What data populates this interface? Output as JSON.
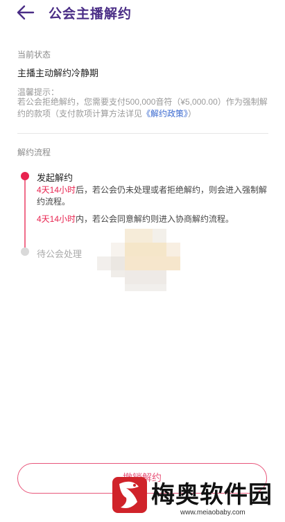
{
  "header": {
    "title": "公会主播解约",
    "back_icon": "arrow-left-icon"
  },
  "status": {
    "label": "当前状态",
    "value": "主播主动解约冷静期"
  },
  "tip": {
    "title": "温馨提示：",
    "body_prefix": "若公会拒绝解约，您需要支付500,000音符（¥5,000.00）作为强制解约的款项（支付款项计算方法详见",
    "link_text": "《解约政策》",
    "body_suffix": "）"
  },
  "process": {
    "label": "解约流程",
    "steps": [
      {
        "title": "发起解约",
        "lines": [
          {
            "highlight": "4天14小时",
            "text": "后，若公会仍未处理或者拒绝解约，则会进入强制解约流程。"
          },
          {
            "highlight": "4天14小时",
            "text": "内，若公会同意解约则进入协商解约流程。"
          }
        ]
      },
      {
        "title": "待公会处理"
      }
    ]
  },
  "bottom_button": {
    "label": "撤销解约"
  },
  "watermark": {
    "text": "梅奥软件园",
    "url": "www.meiaobaby.com"
  },
  "colors": {
    "title": "#4a2d86",
    "accent": "#e8234f",
    "link": "#3b6ad0"
  }
}
